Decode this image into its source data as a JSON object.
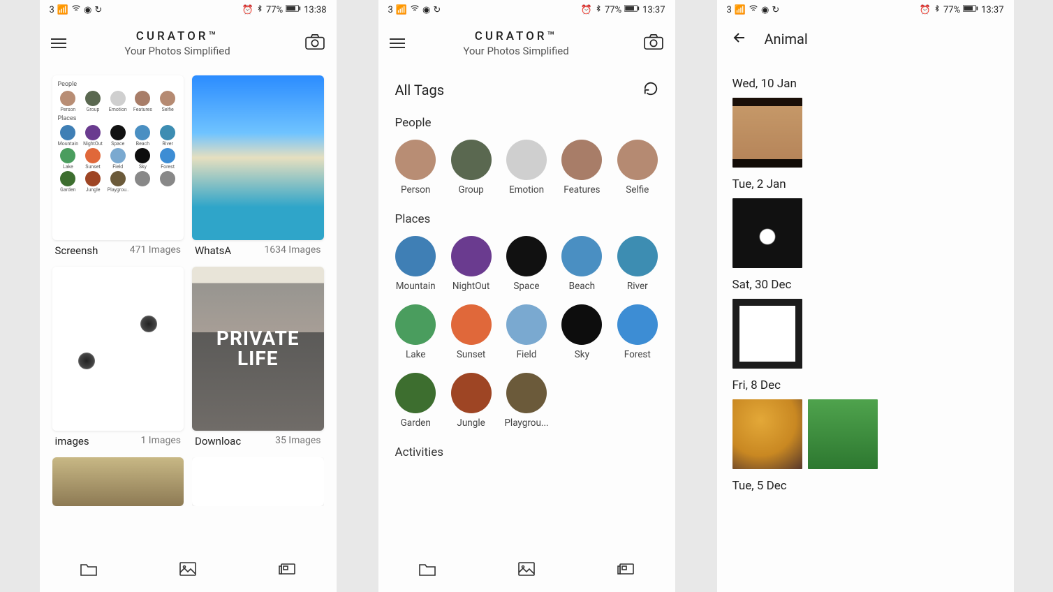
{
  "status": {
    "carrier": "3",
    "battery": "77%",
    "time1": "13:38",
    "time2": "13:37",
    "time3": "13:37"
  },
  "app": {
    "title": "CURATOR™",
    "subtitle": "Your Photos Simplified"
  },
  "screen1": {
    "preview": {
      "section1": "People",
      "section2": "Places",
      "people": [
        "Person",
        "Group",
        "Emotion",
        "Features",
        "Selfie"
      ],
      "places": [
        "Mountain",
        "NightOut",
        "Space",
        "Beach",
        "River",
        "Lake",
        "Sunset",
        "Field",
        "Sky",
        "Forest",
        "Garden",
        "Jungle",
        "Playgrou..."
      ]
    },
    "folders": [
      {
        "name": "Screensh",
        "count": "471 Images"
      },
      {
        "name": "WhatsA",
        "count": "1634 Images"
      },
      {
        "name": "images",
        "count": "1 Images"
      },
      {
        "name": "Downloac",
        "count": "35 Images"
      }
    ]
  },
  "screen2": {
    "header": "All Tags",
    "sections": {
      "people": {
        "title": "People",
        "items": [
          "Person",
          "Group",
          "Emotion",
          "Features",
          "Selfie"
        ]
      },
      "places": {
        "title": "Places",
        "items": [
          "Mountain",
          "NightOut",
          "Space",
          "Beach",
          "River",
          "Lake",
          "Sunset",
          "Field",
          "Sky",
          "Forest",
          "Garden",
          "Jungle",
          "Playgrou..."
        ]
      },
      "activities": {
        "title": "Activities"
      }
    }
  },
  "screen3": {
    "title": "Animal",
    "groups": [
      {
        "date": "Wed, 10 Jan",
        "count": 1
      },
      {
        "date": "Tue, 2 Jan",
        "count": 1
      },
      {
        "date": "Sat, 30 Dec",
        "count": 1
      },
      {
        "date": "Fri, 8 Dec",
        "count": 2
      },
      {
        "date": "Tue, 5 Dec",
        "count": 0
      }
    ]
  },
  "tag_colors": {
    "Person": "#b88d74",
    "Group": "#5a6850",
    "Emotion": "#cfcfcf",
    "Features": "#a87d68",
    "Selfie": "#b58a72",
    "Mountain": "#3f7fb5",
    "NightOut": "#6a3b8f",
    "Space": "#111",
    "Beach": "#4a8fc2",
    "River": "#3d8db2",
    "Lake": "#4a9d5e",
    "Sunset": "#e0683a",
    "Field": "#7aa9d0",
    "Sky": "#0d0d0d",
    "Forest": "#3d8dd4",
    "Garden": "#3d6e2f",
    "Jungle": "#9e4524",
    "Playgrou...": "#6b5a3a"
  }
}
